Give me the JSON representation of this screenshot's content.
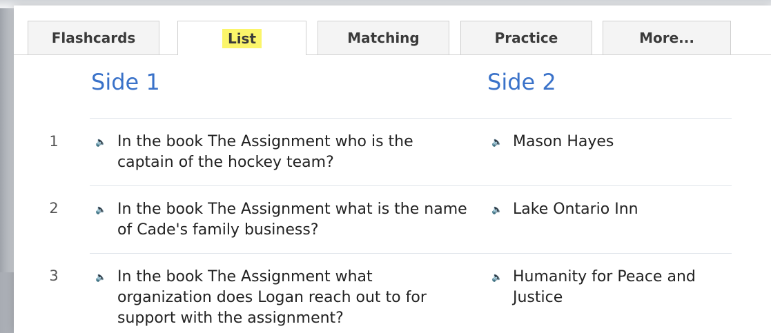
{
  "tabs": [
    {
      "label": "Flashcards"
    },
    {
      "label": "List"
    },
    {
      "label": "Matching"
    },
    {
      "label": "Practice"
    },
    {
      "label": "More..."
    }
  ],
  "active_tab": "List",
  "headers": {
    "side1": "Side 1",
    "side2": "Side 2"
  },
  "rows": [
    {
      "num": "1",
      "term": "In the book The Assignment who is the captain of the hockey team?",
      "definition": "Mason Hayes"
    },
    {
      "num": "2",
      "term": "In the book The Assignment what is the name of Cade's family business?",
      "definition": "Lake Ontario Inn"
    },
    {
      "num": "3",
      "term": "In the book The Assignment what organization does Logan reach out to for support with the assignment?",
      "definition": "Humanity for Peace and Justice"
    }
  ],
  "icons": {
    "speaker": "speaker-icon"
  },
  "colors": {
    "header_blue": "#3a72c9",
    "highlight": "#fbf56a"
  }
}
